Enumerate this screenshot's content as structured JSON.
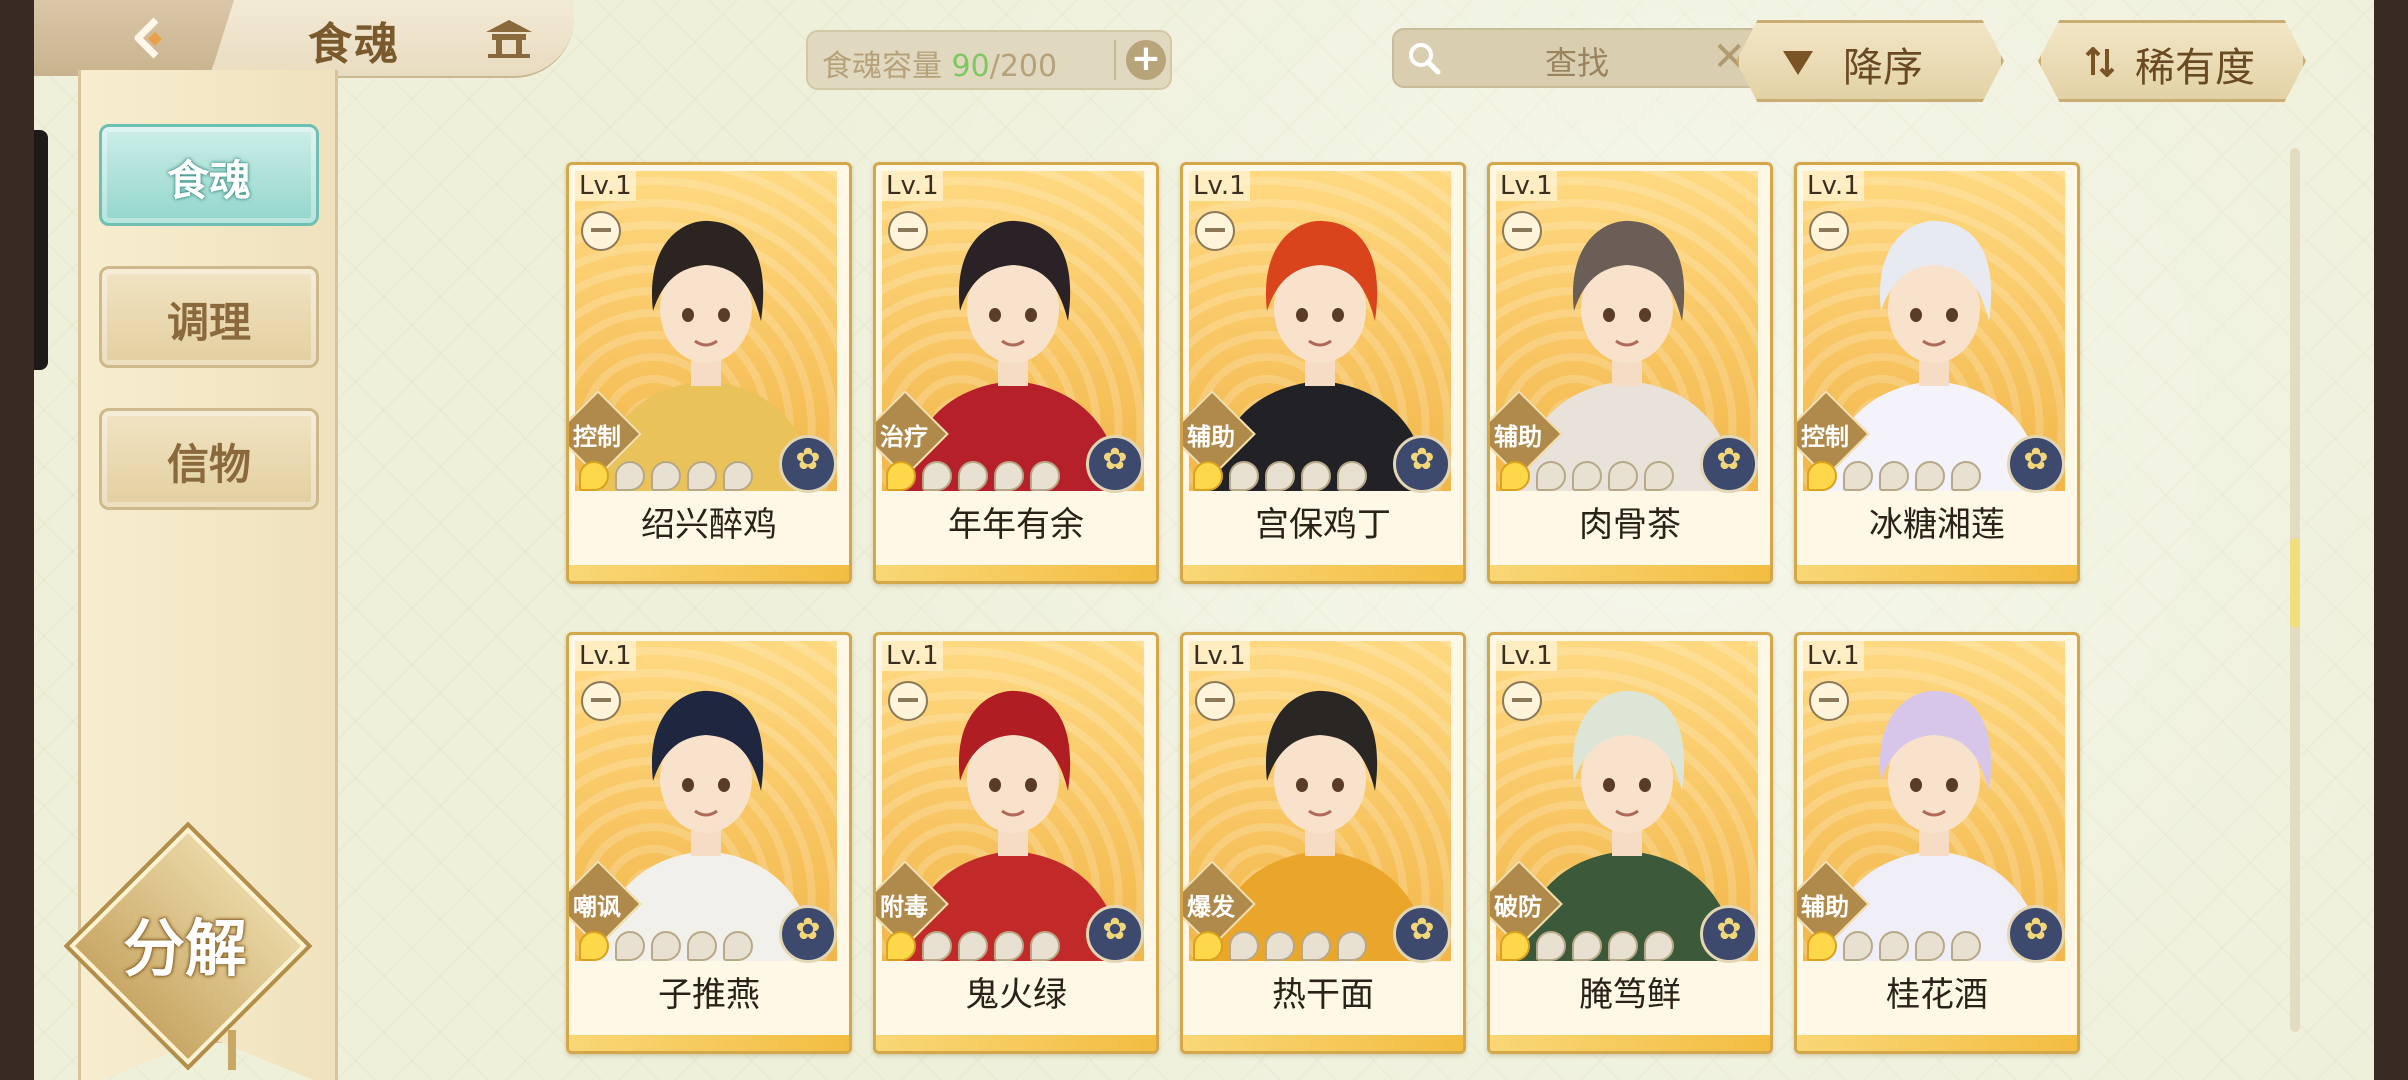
{
  "header": {
    "title": "食魂",
    "capacity_label": "食魂容量 ",
    "capacity_current": "90",
    "capacity_total": "/200",
    "capacity_add": "+",
    "search_placeholder": "查找",
    "search_clear": "✕",
    "sort_order": "降序",
    "sort_by": "稀有度"
  },
  "sidebar": {
    "items": [
      {
        "label": "食魂",
        "active": true
      },
      {
        "label": "调理",
        "active": false
      },
      {
        "label": "信物",
        "active": false
      }
    ],
    "decompose": "分解"
  },
  "cards": [
    {
      "level": "Lv.1",
      "role": "控制",
      "name": "绍兴醉鸡",
      "stars_on": 1,
      "stars_total": 5,
      "palette": {
        "hair": "#2b2420",
        "outfit": "#e9c25a"
      }
    },
    {
      "level": "Lv.1",
      "role": "治疗",
      "name": "年年有余",
      "stars_on": 1,
      "stars_total": 5,
      "palette": {
        "hair": "#2a2226",
        "outfit": "#b5202a"
      }
    },
    {
      "level": "Lv.1",
      "role": "辅助",
      "name": "宫保鸡丁",
      "stars_on": 1,
      "stars_total": 5,
      "palette": {
        "hair": "#d9441c",
        "outfit": "#222226"
      }
    },
    {
      "level": "Lv.1",
      "role": "辅助",
      "name": "肉骨茶",
      "stars_on": 1,
      "stars_total": 5,
      "palette": {
        "hair": "#6a5e56",
        "outfit": "#e8e2da"
      }
    },
    {
      "level": "Lv.1",
      "role": "控制",
      "name": "冰糖湘莲",
      "stars_on": 1,
      "stars_total": 5,
      "palette": {
        "hair": "#e8eaf2",
        "outfit": "#f4f2fa"
      }
    },
    {
      "level": "Lv.1",
      "role": "嘲讽",
      "name": "子推燕",
      "stars_on": 1,
      "stars_total": 5,
      "palette": {
        "hair": "#1f2640",
        "outfit": "#f2f0ea"
      }
    },
    {
      "level": "Lv.1",
      "role": "附毒",
      "name": "鬼火绿",
      "stars_on": 1,
      "stars_total": 5,
      "palette": {
        "hair": "#b01e24",
        "outfit": "#c22a2a"
      }
    },
    {
      "level": "Lv.1",
      "role": "爆发",
      "name": "热干面",
      "stars_on": 1,
      "stars_total": 5,
      "palette": {
        "hair": "#2a2624",
        "outfit": "#e9a62a"
      }
    },
    {
      "level": "Lv.1",
      "role": "破防",
      "name": "腌笃鲜",
      "stars_on": 1,
      "stars_total": 5,
      "palette": {
        "hair": "#dde6d6",
        "outfit": "#3c5a3a"
      }
    },
    {
      "level": "Lv.1",
      "role": "辅助",
      "name": "桂花酒",
      "stars_on": 1,
      "stars_total": 5,
      "palette": {
        "hair": "#d8c6ea",
        "outfit": "#f0eef6"
      }
    }
  ]
}
